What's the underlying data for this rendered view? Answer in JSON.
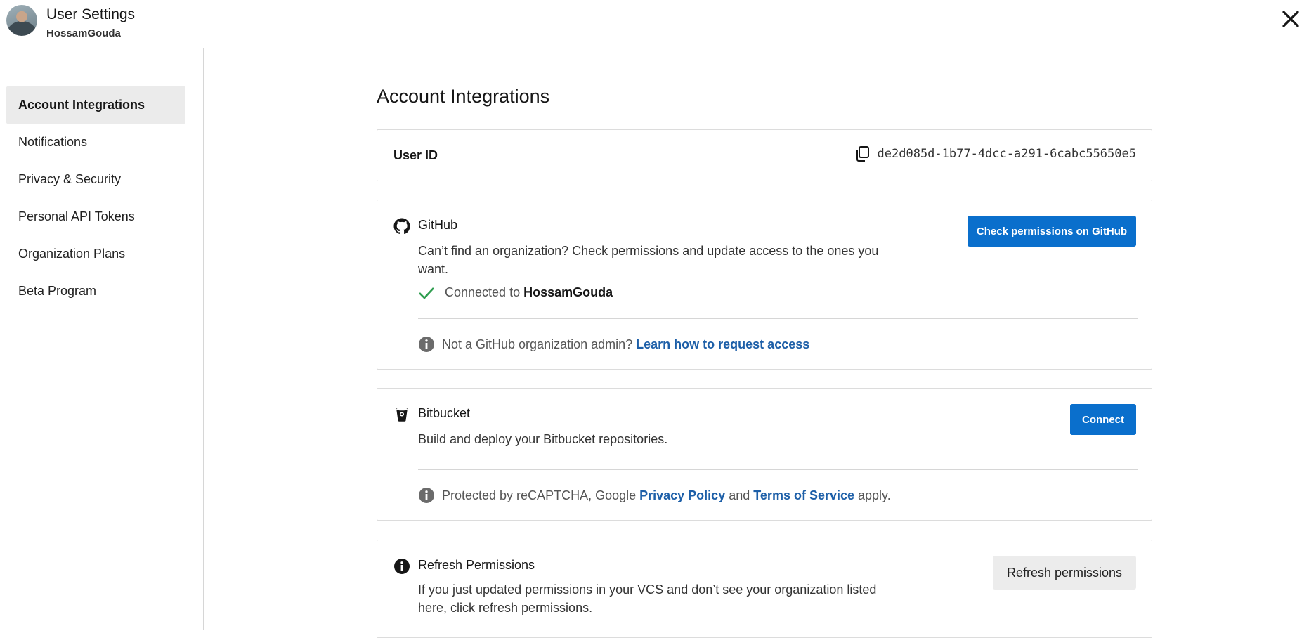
{
  "header": {
    "title": "User Settings",
    "username": "HossamGouda"
  },
  "sidebar": {
    "items": [
      {
        "label": "Account Integrations",
        "active": true
      },
      {
        "label": "Notifications"
      },
      {
        "label": "Privacy & Security"
      },
      {
        "label": "Personal API Tokens"
      },
      {
        "label": "Organization Plans"
      },
      {
        "label": "Beta Program"
      }
    ]
  },
  "main": {
    "title": "Account Integrations",
    "user_id": {
      "label": "User ID",
      "value": "de2d085d-1b77-4dcc-a291-6cabc55650e5"
    },
    "github": {
      "title": "GitHub",
      "description": "Can’t find an organization? Check permissions and update access to the ones you want.",
      "button": "Check permissions on GitHub",
      "connected_prefix": "Connected to",
      "connected_user": "HossamGouda",
      "note": "Not a GitHub organization admin?",
      "note_link": "Learn how to request access"
    },
    "bitbucket": {
      "title": "Bitbucket",
      "description": "Build and deploy your Bitbucket repositories.",
      "button": "Connect",
      "note_prefix": "Protected by reCAPTCHA, Google",
      "privacy_link": "Privacy Policy",
      "note_and": "and",
      "terms_link": "Terms of Service",
      "note_suffix": "apply."
    },
    "refresh": {
      "title": "Refresh Permissions",
      "description": "If you just updated permissions in your VCS and don’t see your organization listed here, click refresh permissions.",
      "button": "Refresh permissions"
    }
  },
  "colors": {
    "primary": "#0a6fcc",
    "link": "#1d5fa8",
    "success": "#2e9d4f",
    "active_bg": "#ebebeb"
  }
}
